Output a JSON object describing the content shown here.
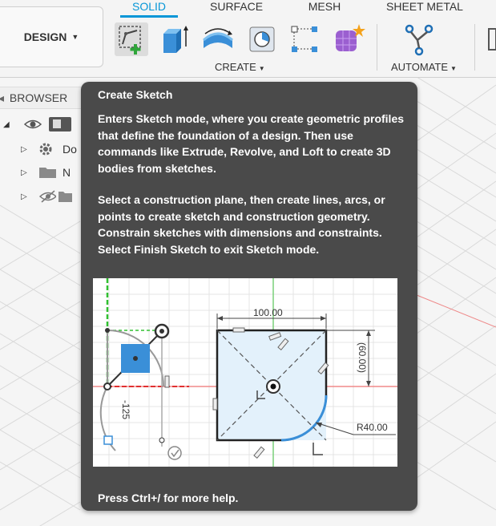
{
  "workspace": {
    "label": "DESIGN"
  },
  "tabs": [
    {
      "label": "SOLID",
      "active": true
    },
    {
      "label": "SURFACE",
      "active": false
    },
    {
      "label": "MESH",
      "active": false
    },
    {
      "label": "SHEET METAL",
      "active": false
    }
  ],
  "groups": {
    "create": {
      "label": "CREATE"
    },
    "automate": {
      "label": "AUTOMATE"
    }
  },
  "tools": [
    "create-sketch-icon",
    "extrude-icon",
    "revolve-icon",
    "hole-icon",
    "sketch-points-icon",
    "form-icon",
    "automate-icon"
  ],
  "browser": {
    "title": "BROWSER",
    "rows": [
      {
        "label": "",
        "icon": "component-icon"
      },
      {
        "label": "Do",
        "icon": "settings-icon"
      },
      {
        "label": "N",
        "icon": "folder-icon"
      },
      {
        "label": "",
        "icon": "folder-icon"
      }
    ]
  },
  "tooltip": {
    "title": "Create Sketch",
    "paragraph1": "Enters Sketch mode, where you create geometric profiles that define the foundation of a design. Then use commands like Extrude, Revolve, and Loft to create 3D bodies from sketches.",
    "paragraph2": "Select a construction plane, then create lines, arcs, or points to create sketch and construction geometry. Constrain sketches with dimensions and constraints. Select Finish Sketch to exit Sketch mode.",
    "footer": "Press Ctrl+/ for more help.",
    "illustration": {
      "dim_width": "100.00",
      "dim_height": "(60.00)",
      "dim_radius": "R40.00",
      "dim_angle": "-125"
    }
  },
  "colors": {
    "accent": "#0696d7",
    "tooltip_bg": "#4a4a4a",
    "axis_red": "#e03030",
    "axis_green": "#30c030"
  }
}
